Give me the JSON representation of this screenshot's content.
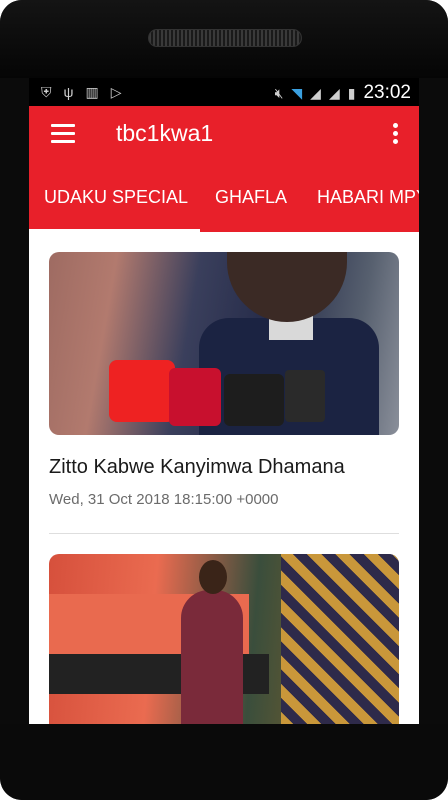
{
  "status_bar": {
    "time": "23:02",
    "left_icons": [
      "shield-icon",
      "usb-icon",
      "barcode-icon",
      "play-store-icon"
    ],
    "right_icons": [
      "mute-icon",
      "wifi-icon",
      "signal-icon",
      "signal-icon-2",
      "battery-icon"
    ]
  },
  "app_bar": {
    "title": "tbc1kwa1",
    "menu_icon": "hamburger-menu-icon",
    "more_icon": "more-vertical-icon",
    "color": "#e8202a"
  },
  "tabs": [
    {
      "label": "UDAKU SPECIAL",
      "selected": true
    },
    {
      "label": "GHAFLA",
      "selected": false
    },
    {
      "label": "HABARI MPY",
      "selected": false
    }
  ],
  "feed": {
    "items": [
      {
        "title": "Zitto Kabwe Kanyimwa Dhamana",
        "date": "Wed, 31 Oct 2018 18:15:00 +0000"
      },
      {
        "title": "",
        "date": ""
      }
    ]
  }
}
